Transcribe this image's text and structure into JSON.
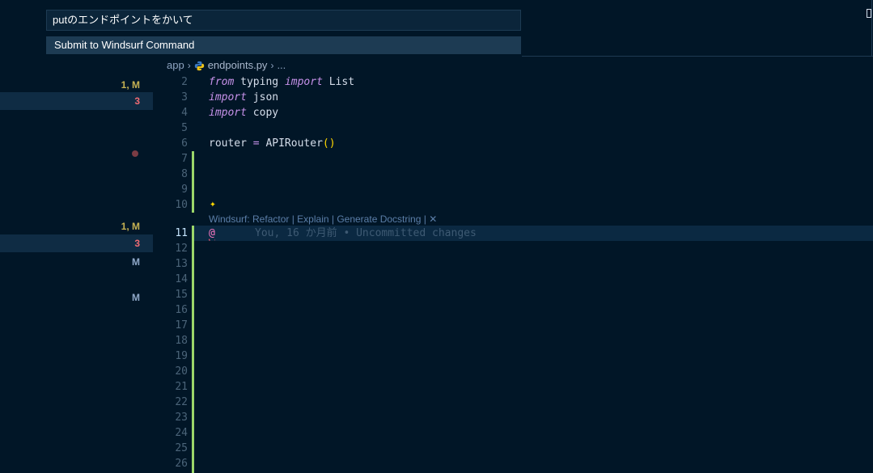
{
  "command": {
    "input_value": "putのエンドポイントをかいて",
    "suggestion": "Submit to Windsurf Command"
  },
  "breadcrumb": {
    "folder": "app",
    "file": "endpoints.py",
    "more": "..."
  },
  "scm": {
    "rows": [
      {
        "label": "1, M"
      },
      {
        "label": "3"
      },
      {
        "label": "1, M"
      },
      {
        "label": "3"
      },
      {
        "label": "M"
      },
      {
        "label": "M"
      }
    ]
  },
  "editor": {
    "lines": [
      {
        "num": "2"
      },
      {
        "num": "3"
      },
      {
        "num": "4"
      },
      {
        "num": "5"
      },
      {
        "num": "6"
      },
      {
        "num": "7"
      },
      {
        "num": "8"
      },
      {
        "num": "9"
      },
      {
        "num": "10"
      },
      {
        "num": "11"
      },
      {
        "num": "12"
      },
      {
        "num": "13"
      },
      {
        "num": "14"
      },
      {
        "num": "15"
      },
      {
        "num": "16"
      },
      {
        "num": "17"
      },
      {
        "num": "18"
      },
      {
        "num": "19"
      },
      {
        "num": "20"
      },
      {
        "num": "21"
      },
      {
        "num": "22"
      },
      {
        "num": "23"
      },
      {
        "num": "24"
      },
      {
        "num": "25"
      },
      {
        "num": "26"
      }
    ],
    "code": {
      "l2_from": "from",
      "l2_mod": " typing ",
      "l2_import": "import",
      "l2_name": " List",
      "l3_import": "import",
      "l3_name": " json",
      "l4_import": "import",
      "l4_name": " copy",
      "l6_var": "router ",
      "l6_eq": "=",
      "l6_call": " APIRouter",
      "l6_paren": "()",
      "l11_at": "@",
      "l11_ghost": "You, 16 か月前 • Uncommitted changes"
    },
    "codelens": {
      "prefix": "Windsurf: ",
      "refactor": "Refactor",
      "sep1": " | ",
      "explain": "Explain",
      "sep2": " | ",
      "docstring": "Generate Docstring",
      "sep3": " | ",
      "close": "✕"
    },
    "sparkle_icon": "✦"
  },
  "colors": {
    "background": "#011627",
    "keyword": "#c792ea",
    "gutter_added": "#9cd66a",
    "badge_error": "#ef6b73",
    "badge_modified": "#c5b153"
  }
}
